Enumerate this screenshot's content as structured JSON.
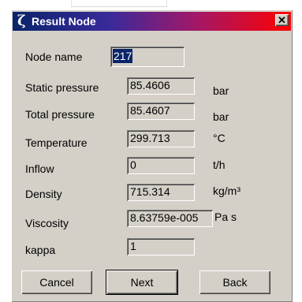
{
  "window": {
    "title": "Result Node",
    "icon": "zeta-icon",
    "icon_glyph": "ζ",
    "close_glyph": "✕"
  },
  "node": {
    "label": "Node name",
    "value": "217"
  },
  "fields": [
    {
      "label": "Static pressure",
      "value": "85.4606",
      "unit": "bar"
    },
    {
      "label": "Total pressure",
      "value": "85.4607",
      "unit": "bar"
    },
    {
      "label": "Temperature",
      "value": "299.713",
      "unit": "°C"
    },
    {
      "label": "Inflow",
      "value": "0",
      "unit": "t/h"
    },
    {
      "label": "Density",
      "value": "715.314",
      "unit": "kg/m³"
    },
    {
      "label": "Viscosity",
      "value": "8.63759e-005",
      "unit": "Pa s"
    },
    {
      "label": "kappa",
      "value": "1",
      "unit": ""
    }
  ],
  "buttons": {
    "cancel": "Cancel",
    "next": "Next",
    "back": "Back"
  }
}
